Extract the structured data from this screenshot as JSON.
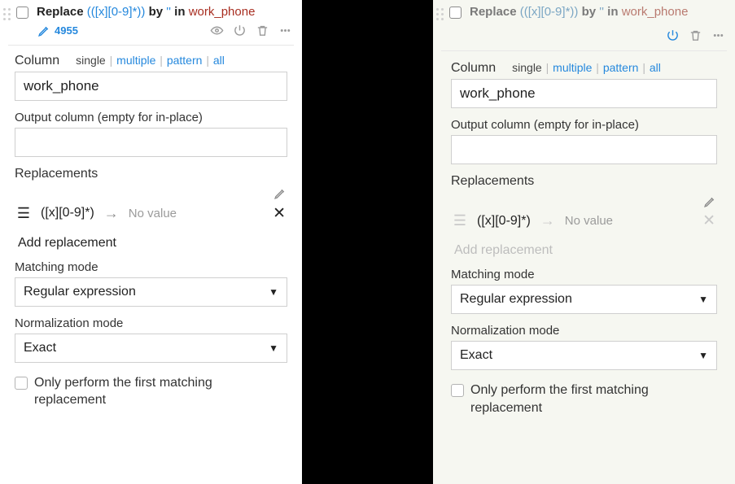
{
  "left": {
    "title_bold": "Replace",
    "title_pattern": "([x][0-9]*)",
    "title_by": "by",
    "title_repl": "''",
    "title_in": "in",
    "title_col": "work_phone",
    "id": "4955",
    "column_label": "Column",
    "modes": {
      "selected": "single",
      "options": [
        "multiple",
        "pattern",
        "all"
      ]
    },
    "column_value": "work_phone",
    "output_label": "Output column (empty for in-place)",
    "output_value": "",
    "replacements_label": "Replacements",
    "repl_pattern": "([x][0-9]*)",
    "repl_noval": "No value",
    "add_replacement": "Add replacement",
    "matching_label": "Matching mode",
    "matching_value": "Regular expression",
    "normalization_label": "Normalization mode",
    "normalization_value": "Exact",
    "first_only": "Only perform the first matching replacement"
  },
  "right": {
    "title_bold": "Replace",
    "title_pattern": "([x][0-9]*)",
    "title_by": "by",
    "title_repl": "''",
    "title_in": "in",
    "title_col": "work_phone",
    "column_label": "Column",
    "modes": {
      "selected": "single",
      "options": [
        "multiple",
        "pattern",
        "all"
      ]
    },
    "column_value": "work_phone",
    "output_label": "Output column (empty for in-place)",
    "output_value": "",
    "replacements_label": "Replacements",
    "repl_pattern": "([x][0-9]*)",
    "repl_noval": "No value",
    "add_replacement": "Add replacement",
    "matching_label": "Matching mode",
    "matching_value": "Regular expression",
    "normalization_label": "Normalization mode",
    "normalization_value": "Exact",
    "first_only": "Only perform the first matching replacement"
  }
}
